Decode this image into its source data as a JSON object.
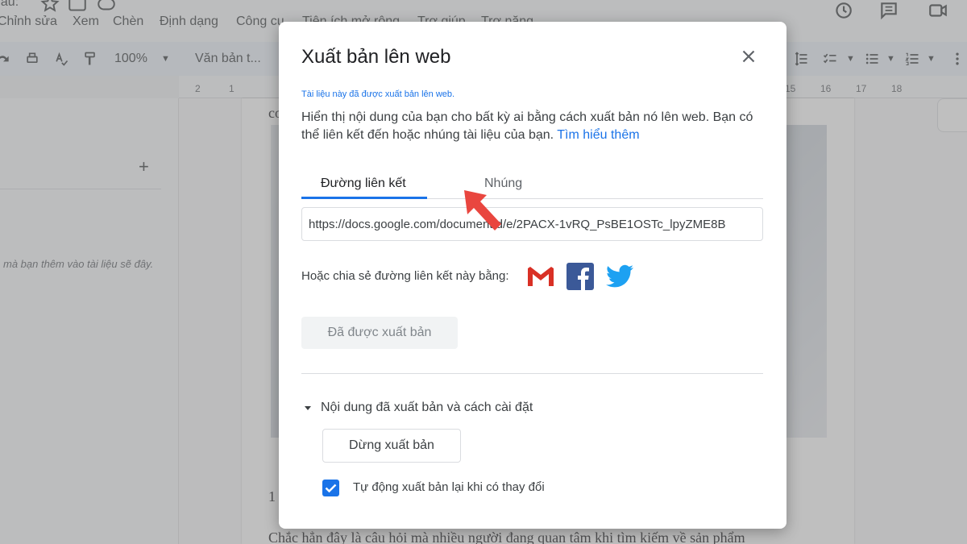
{
  "menubar": {
    "doc_title_fragment": "đầu:",
    "items": [
      "Chỉnh sửa",
      "Xem",
      "Chèn",
      "Định dạng",
      "Công cụ",
      "Tiện ích mở rộng",
      "Trợ giúp",
      "Trợ năng"
    ]
  },
  "toolbar": {
    "zoom": "100%",
    "style": "Văn bản t..."
  },
  "ruler": {
    "left_numbers": [
      "2",
      "1"
    ],
    "right_numbers": [
      "15",
      "16",
      "17",
      "18"
    ]
  },
  "sidebar": {
    "plus": "+",
    "hint": "mà bạn thêm vào tài liệu sẽ đây."
  },
  "page": {
    "fragment_top": "co",
    "fragment_num": "1",
    "fragment_bottom": "Chắc hẳn đây là câu hỏi mà nhiều người đang quan tâm khi tìm kiếm về sản phẩm"
  },
  "dialog": {
    "title": "Xuất bản lên web",
    "status": "Tài liệu này đã được xuất bản lên web.",
    "description": "Hiển thị nội dung của bạn cho bất kỳ ai bằng cách xuất bản nó lên web. Bạn có thể liên kết đến hoặc nhúng tài liệu của bạn.",
    "learn_more": "Tìm hiểu thêm",
    "tabs": [
      {
        "label": "Đường liên kết",
        "active": true
      },
      {
        "label": "Nhúng",
        "active": false
      }
    ],
    "url": "https://docs.google.com/document/d/e/2PACX-1vRQ_PsBE1OSTc_lpyZME8B",
    "share_label": "Hoặc chia sẻ đường liên kết này bằng:",
    "share_icons": [
      "gmail-icon",
      "facebook-icon",
      "twitter-icon"
    ],
    "published_button": "Đã được xuất bản",
    "section_label": "Nội dung đã xuất bản và cách cài đặt",
    "stop_button": "Dừng xuất bản",
    "auto_republish_label": "Tự động xuất bản lại khi có thay đổi",
    "auto_republish_checked": true
  },
  "colors": {
    "accent": "#1a73e8",
    "annotation_arrow": "#e9463f",
    "gmail_red": "#d93025",
    "facebook_blue": "#3b5998",
    "twitter_blue": "#1da1f2"
  }
}
